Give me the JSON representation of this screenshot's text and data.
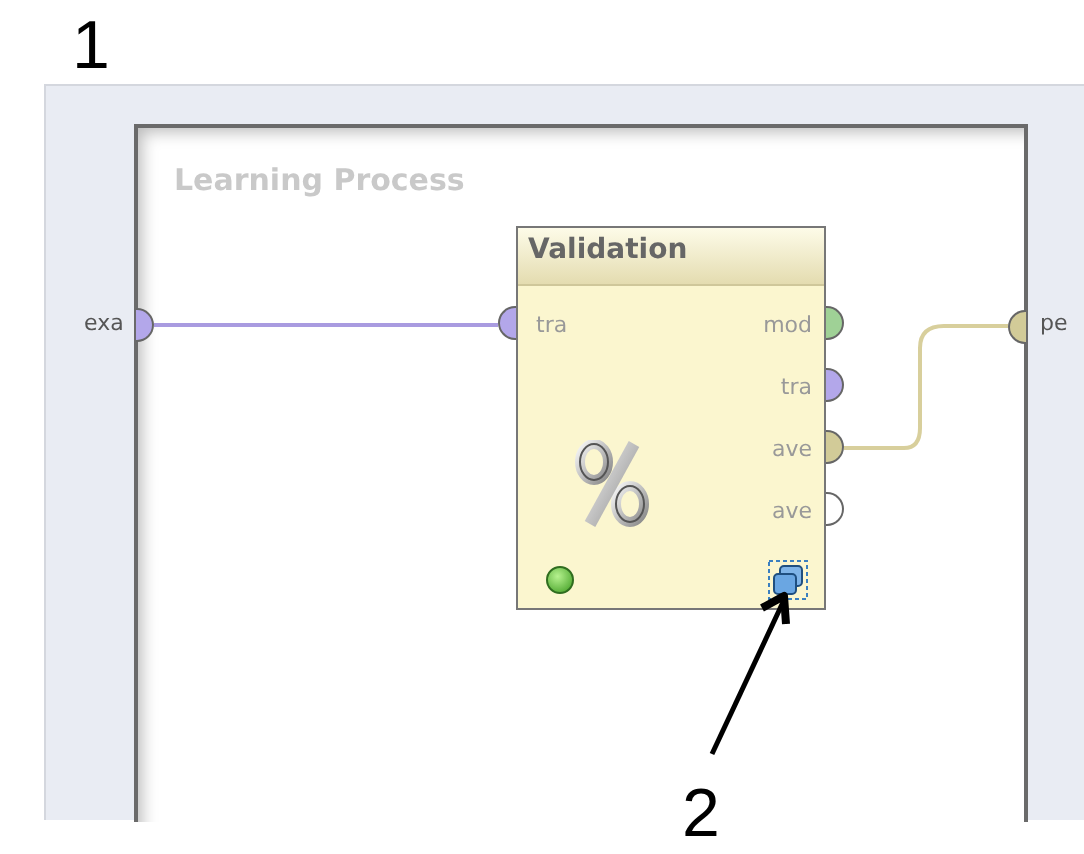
{
  "annotations": [
    {
      "label": "1"
    },
    {
      "label": "2"
    }
  ],
  "process": {
    "title": "Learning Process",
    "input_ports": [
      {
        "label": "exa",
        "color": "#b3a7ea"
      }
    ],
    "output_ports": [
      {
        "label": "pe",
        "color": "#d2cb98"
      }
    ]
  },
  "operator": {
    "title": "Validation",
    "ready": true,
    "input_ports": [
      {
        "label": "tra",
        "color": "#b3a7ea"
      }
    ],
    "output_ports": [
      {
        "label": "mod",
        "color": "#9fd196"
      },
      {
        "label": "tra",
        "color": "#b3a7ea"
      },
      {
        "label": "ave",
        "color": "#d2cb98"
      },
      {
        "label": "ave",
        "color": "#ffffff"
      }
    ]
  }
}
